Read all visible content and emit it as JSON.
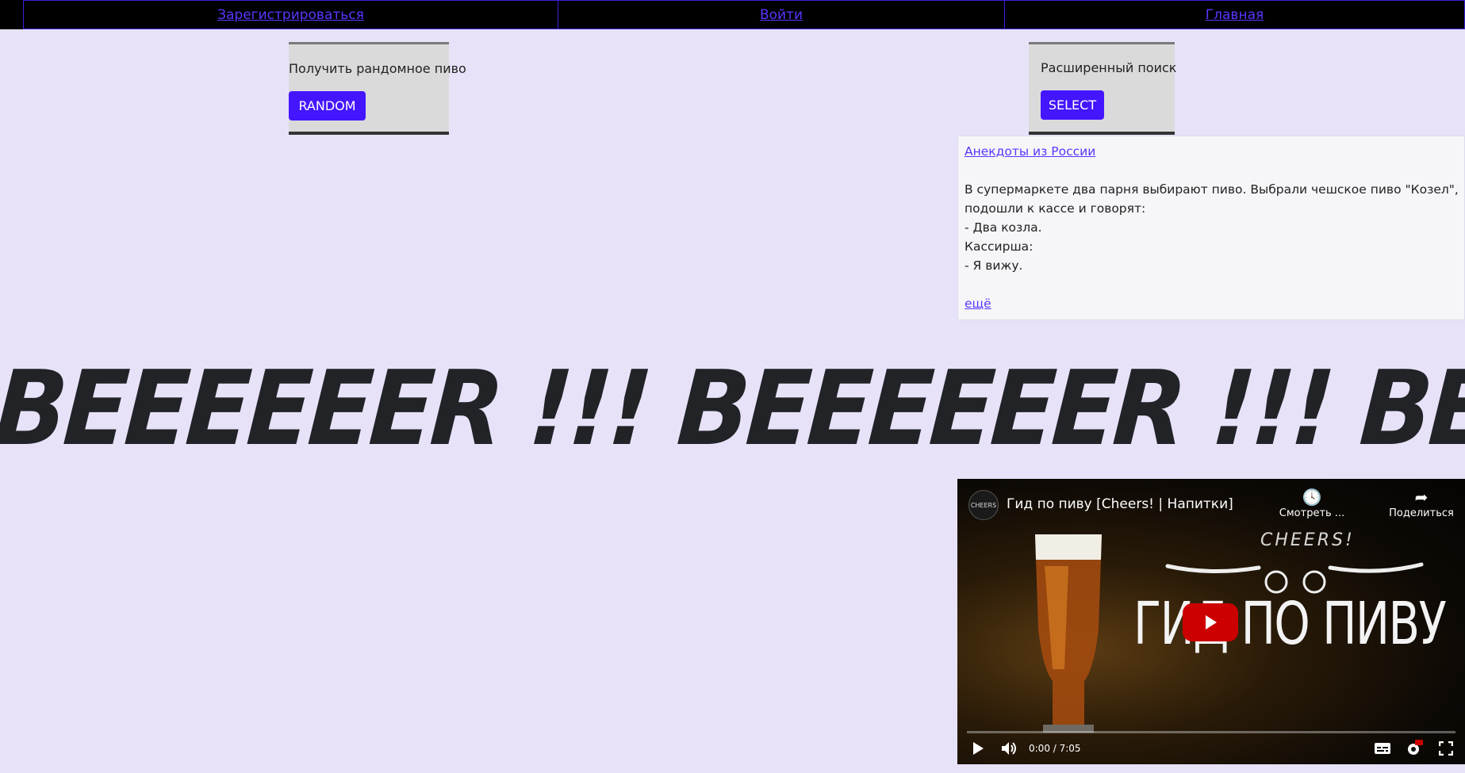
{
  "nav": {
    "register": "Зарегистрироваться",
    "login": "Войти",
    "home": "Главная"
  },
  "random_card": {
    "text": "Получить рандомное пиво",
    "button": "RANDOM"
  },
  "search_card": {
    "text": "Расширенный поиск",
    "button": "SELECT"
  },
  "joke": {
    "source_link": "Анекдоты из России",
    "lines": [
      "В супермаркете два парня выбирают пиво. Выбрали чешское пиво \"Козел\",",
      "подошли к кассе и говорят:",
      "- Два козла.",
      "Кассирша:",
      "- Я вижу."
    ],
    "more_link": "ещё"
  },
  "banner": {
    "text": "BEEEEEER !!! BEEEEEER !!! BEEEEEER !!!"
  },
  "video": {
    "title": "Гид по пиву [Cheers! | Напитки]",
    "watch_later": "Смотреть ...",
    "share": "Поделиться",
    "channel": "CHEERS",
    "thumb_brand": "CHEERS!",
    "thumb_title": "ГИД ПО ПИВУ",
    "time": "0:00 / 7:05"
  },
  "colors": {
    "page_bg": "#e8e2f9",
    "accent": "#4416ff",
    "link": "#5b35ff"
  }
}
